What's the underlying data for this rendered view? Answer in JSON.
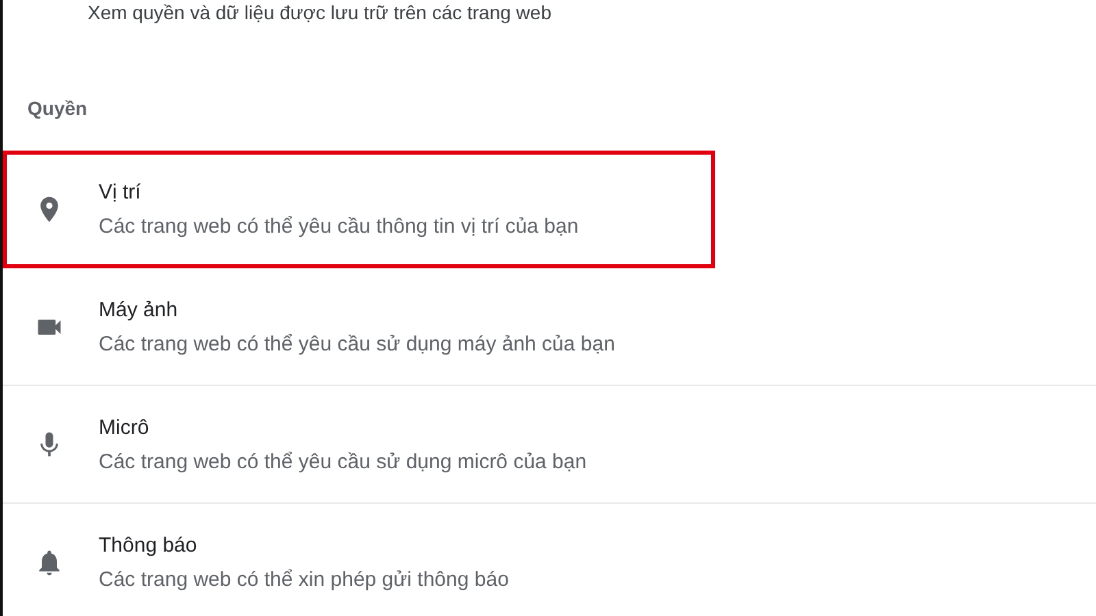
{
  "description": "Xem quyền và dữ liệu được lưu trữ trên các trang web",
  "section_title": "Quyền",
  "permissions": [
    {
      "kind": "location",
      "title": "Vị trí",
      "subtitle": "Các trang web có thể yêu cầu thông tin vị trí của bạn",
      "highlighted": true
    },
    {
      "kind": "camera",
      "title": "Máy ảnh",
      "subtitle": "Các trang web có thể yêu cầu sử dụng máy ảnh của bạn",
      "highlighted": false
    },
    {
      "kind": "microphone",
      "title": "Micrô",
      "subtitle": "Các trang web có thể yêu cầu sử dụng micrô của bạn",
      "highlighted": false
    },
    {
      "kind": "notifications",
      "title": "Thông báo",
      "subtitle": "Các trang web có thể xin phép gửi thông báo",
      "highlighted": false
    }
  ]
}
